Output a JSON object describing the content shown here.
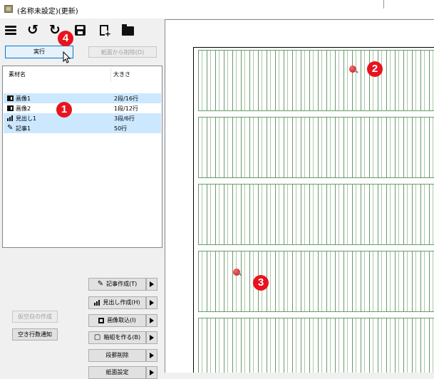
{
  "window": {
    "title": "(名称未設定)(更新)"
  },
  "toolbar": {
    "icons": [
      "menu-icon",
      "undo-icon",
      "redo-icon",
      "save-icon",
      "new-document-icon",
      "open-folder-icon"
    ]
  },
  "buttons": {
    "run": "実行",
    "remove_from_paper": "紙面から削除(D)"
  },
  "list": {
    "headers": {
      "name": "素材名",
      "size": "大きさ"
    },
    "rows": [
      {
        "icon": "image-icon",
        "name": "画像1",
        "size": "2段/16行",
        "selected": true
      },
      {
        "icon": "image-icon",
        "name": "画像2",
        "size": "1段/12行",
        "selected": false
      },
      {
        "icon": "bar-chart-icon",
        "name": "見出し1",
        "size": "3段/6行",
        "selected": true
      },
      {
        "icon": "pencil-icon",
        "name": "記事1",
        "size": "50行",
        "selected": true
      }
    ]
  },
  "side_buttons": [
    {
      "icon": "pencil-icon",
      "label": "記事作成(T)"
    },
    {
      "icon": "bar-chart-icon",
      "label": "見出し作成(H)"
    },
    {
      "icon": "image-icon",
      "label": "画像取込(I)"
    },
    {
      "icon": "cube-icon",
      "label": "箱組を作る(B)"
    },
    {
      "icon": "",
      "label": "段罫削除"
    },
    {
      "icon": "",
      "label": "紙面設定"
    }
  ],
  "left_buttons": {
    "temp_blank": "仮空白の作成",
    "notify_empty_rows": "空き行数通知"
  },
  "callouts": {
    "one": "1",
    "two": "2",
    "three": "3",
    "four": "4"
  },
  "colors": {
    "callout": "#e8141d",
    "selection": "#cce8ff",
    "grid": "#6a9a6a"
  }
}
